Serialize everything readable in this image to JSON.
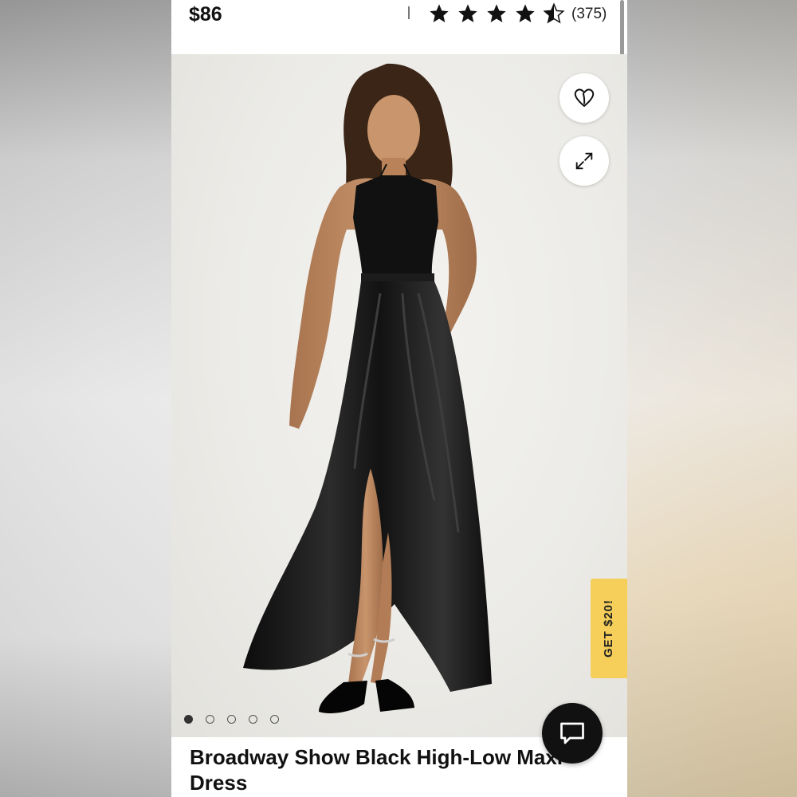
{
  "product": {
    "price": "$86",
    "rating": 4.5,
    "rating_max": 5,
    "review_count": "(375)",
    "title": "Broadway Show Black High-Low Maxi Dress"
  },
  "icons": {
    "wishlist": "heart-icon",
    "zoom": "expand-icon",
    "chat": "chat-icon",
    "star": "star-icon"
  },
  "gallery": {
    "image_count": 5,
    "active_index": 0
  },
  "promo": {
    "label": "GET $20!"
  },
  "colors": {
    "promo_tab": "#f5cf5a",
    "chat_button": "#111111",
    "star": "#111111"
  }
}
